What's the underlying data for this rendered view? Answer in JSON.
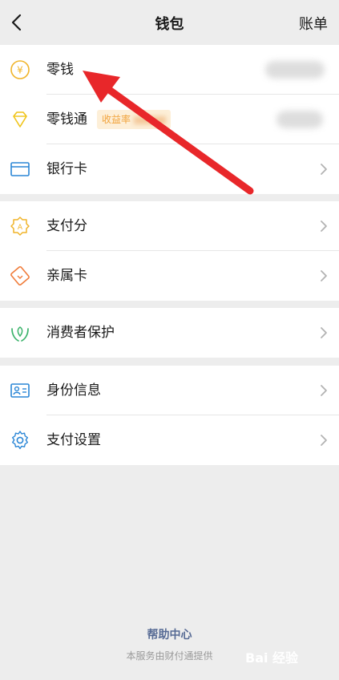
{
  "nav": {
    "back_icon": "chevron-left-icon",
    "title": "钱包",
    "bill_label": "账单"
  },
  "rows": {
    "change": {
      "label": "零钱",
      "icon": "yuan-coin-icon",
      "value": ""
    },
    "licaitong": {
      "label": "零钱通",
      "badge": "收益率 ",
      "icon": "diamond-icon",
      "value": ""
    },
    "bank_card": {
      "label": "银行卡",
      "icon": "card-icon"
    },
    "pay_score": {
      "label": "支付分",
      "icon": "score-badge-icon"
    },
    "family_card": {
      "label": "亲属卡",
      "icon": "family-card-icon"
    },
    "consumer_protection": {
      "label": "消费者保护",
      "icon": "shield-hands-icon"
    },
    "identity": {
      "label": "身份信息",
      "icon": "id-card-icon"
    },
    "pay_settings": {
      "label": "支付设置",
      "icon": "gear-icon"
    }
  },
  "footer": {
    "help": "帮助中心",
    "note": "本服务由财付通提供"
  },
  "watermark": {
    "text": "Bai 经验"
  },
  "colors": {
    "background": "#ededed",
    "link_blue": "#576b95",
    "badge_orange": "#f1a33c",
    "annotation_red": "#e8272a"
  }
}
